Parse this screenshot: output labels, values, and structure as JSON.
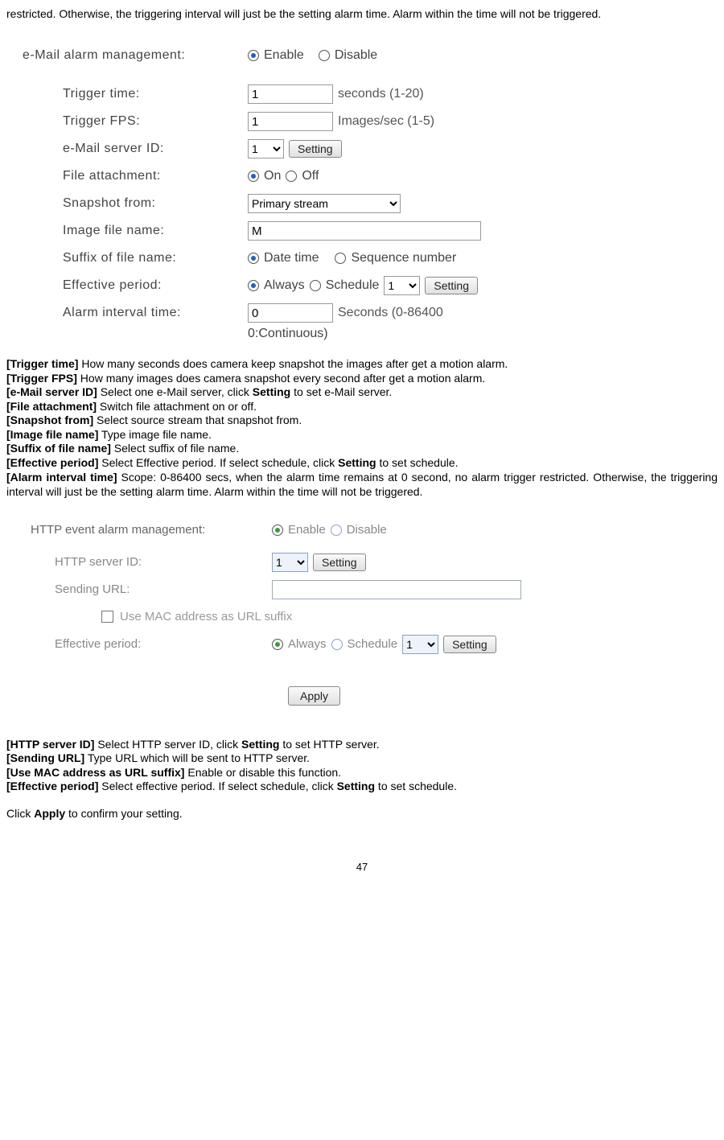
{
  "intro_text": "restricted. Otherwise, the triggering interval will just be the setting alarm time. Alarm within the time will not be triggered.",
  "email_form": {
    "title_label": "e-Mail alarm management:",
    "enable": "Enable",
    "disable": "Disable",
    "trigger_time_label": "Trigger time:",
    "trigger_time_value": "1",
    "trigger_time_suffix": "seconds (1-20)",
    "trigger_fps_label": "Trigger FPS:",
    "trigger_fps_value": "1",
    "trigger_fps_suffix": "Images/sec (1-5)",
    "server_id_label": "e-Mail server ID:",
    "server_id_value": "1",
    "setting_btn": "Setting",
    "file_attach_label": "File attachment:",
    "on": "On",
    "off": "Off",
    "snapshot_from_label": "Snapshot from:",
    "snapshot_from_value": "Primary stream",
    "image_file_label": "Image file name:",
    "image_file_value": "M",
    "suffix_label": "Suffix of file name:",
    "date_time": "Date time",
    "seq_num": "Sequence number",
    "effective_label": "Effective period:",
    "always": "Always",
    "schedule": "Schedule",
    "schedule_value": "1",
    "alarm_interval_label": "Alarm interval time:",
    "alarm_interval_value": "0",
    "alarm_interval_suffix": "Seconds (0-86400",
    "alarm_interval_line2": "0:Continuous)"
  },
  "descriptions": {
    "l1b": "[Trigger time]",
    "l1": " How many seconds does camera keep snapshot the images after get a motion alarm.",
    "l2b": "[Trigger FPS]",
    "l2": " How many images does camera snapshot every second after get a motion alarm.",
    "l3b": "[e-Mail server ID]",
    "l3a": " Select one e-Mail server, click ",
    "l3s": "Setting",
    "l3c": " to set e-Mail server.",
    "l4b": "[File attachment]",
    "l4": " Switch file attachment on or off.",
    "l5b": "[Snapshot from]",
    "l5": " Select source stream that snapshot from.",
    "l6b": "[Image file name]",
    "l6": " Type image file name.",
    "l7b": "[Suffix of file name]",
    "l7": " Select suffix of file name.",
    "l8b": "[Effective period]",
    "l8a": " Select Effective period. If select schedule, click ",
    "l8s": "Setting",
    "l8c": " to set schedule.",
    "l9b": "[Alarm interval time]",
    "l9": " Scope: 0-86400 secs, when the alarm time remains at 0 second, no alarm trigger restricted. Otherwise, the triggering interval will just be the setting alarm time. Alarm within the time will not be triggered."
  },
  "http_form": {
    "title_label": "HTTP event alarm management:",
    "enable": "Enable",
    "disable": "Disable",
    "server_id_label": "HTTP server ID:",
    "server_id_value": "1",
    "setting_btn": "Setting",
    "sending_url_label": "Sending URL:",
    "sending_url_value": "",
    "mac_suffix_label": "Use MAC address as URL suffix",
    "effective_label": "Effective period:",
    "always": "Always",
    "schedule": "Schedule",
    "schedule_value": "1",
    "apply_btn": "Apply"
  },
  "descriptions2": {
    "l1b": "[HTTP server ID]",
    "l1a": " Select HTTP server ID, click ",
    "l1s": "Setting",
    "l1c": " to set HTTP server.",
    "l2b": "[Sending URL]",
    "l2": " Type URL which will be sent to HTTP server.",
    "l3b": "[Use MAC address as URL suffix]",
    "l3": " Enable or disable this function.",
    "l4b": "[Effective period]",
    "l4a": " Select effective period. If select schedule, click ",
    "l4s": "Setting",
    "l4c": " to set schedule.",
    "finalA": "Click ",
    "finalB": "Apply",
    "finalC": " to confirm your setting."
  },
  "page_number": "47"
}
